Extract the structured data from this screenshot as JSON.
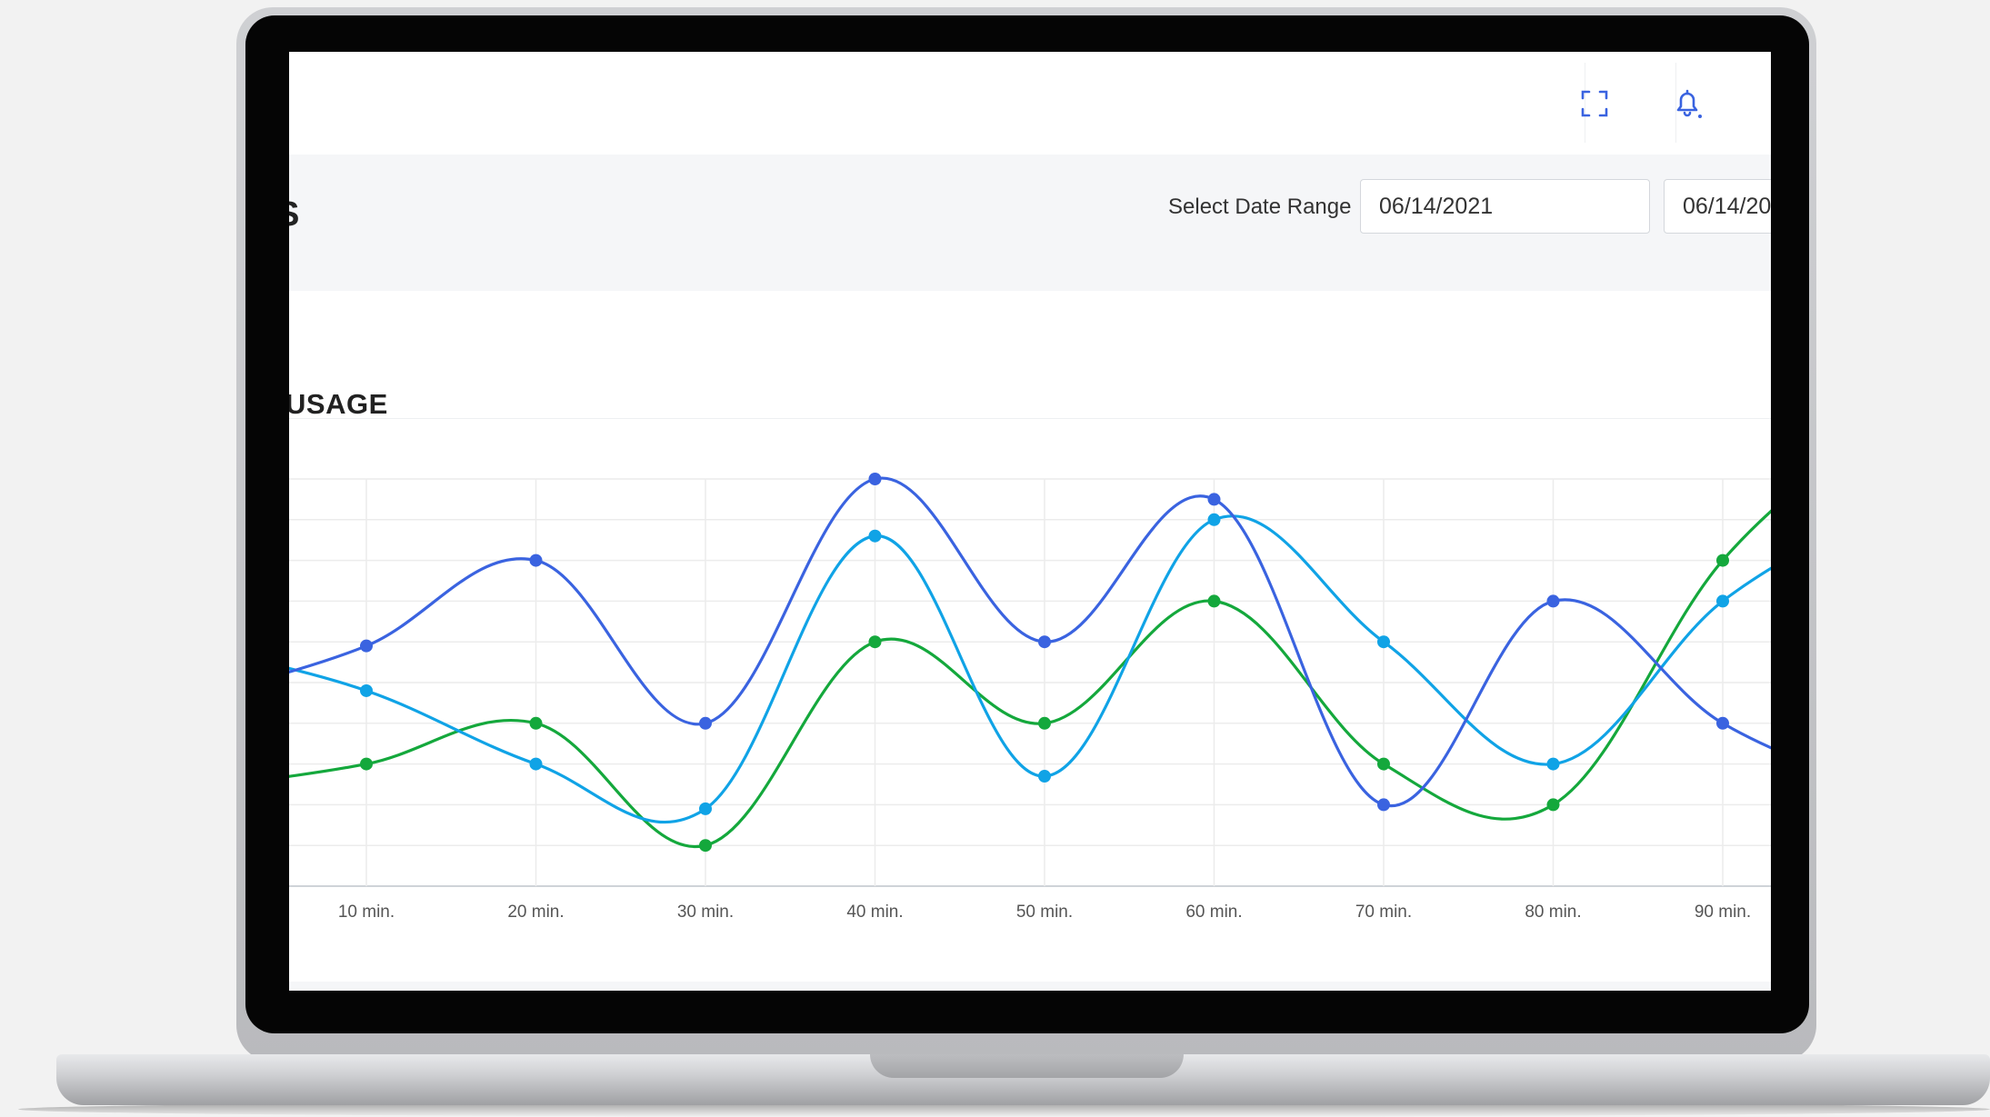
{
  "header": {
    "page_title_fragment": "S",
    "date_range_label": "Select Date Range",
    "start_date": "06/14/2021",
    "end_date": "06/14/20"
  },
  "topbar": {
    "icons": [
      "fullscreen-icon",
      "bell-icon"
    ]
  },
  "card": {
    "title": "USAGE"
  },
  "colors": {
    "series_1": "#3a63e0",
    "series_2": "#10a3e6",
    "series_3": "#14a83c"
  },
  "chart_data": {
    "type": "line",
    "title": "USAGE",
    "categories": [
      "10 min.",
      "20 min.",
      "30 min.",
      "40 min.",
      "50 min.",
      "60 min.",
      "70 min.",
      "80 min.",
      "90 min."
    ],
    "ylim": [
      0,
      10
    ],
    "grid": true,
    "smooth": true,
    "series": [
      {
        "color": "#3a63e0",
        "values": [
          5.9,
          8.0,
          4.0,
          10.0,
          6.0,
          9.5,
          2.0,
          7.0,
          4.0
        ]
      },
      {
        "color": "#10a3e6",
        "values": [
          4.8,
          3.0,
          1.9,
          8.6,
          2.7,
          9.0,
          6.0,
          3.0,
          7.0
        ]
      },
      {
        "color": "#14a83c",
        "values": [
          3.0,
          4.0,
          1.0,
          6.0,
          4.0,
          7.0,
          3.0,
          2.0,
          8.0
        ]
      }
    ]
  }
}
